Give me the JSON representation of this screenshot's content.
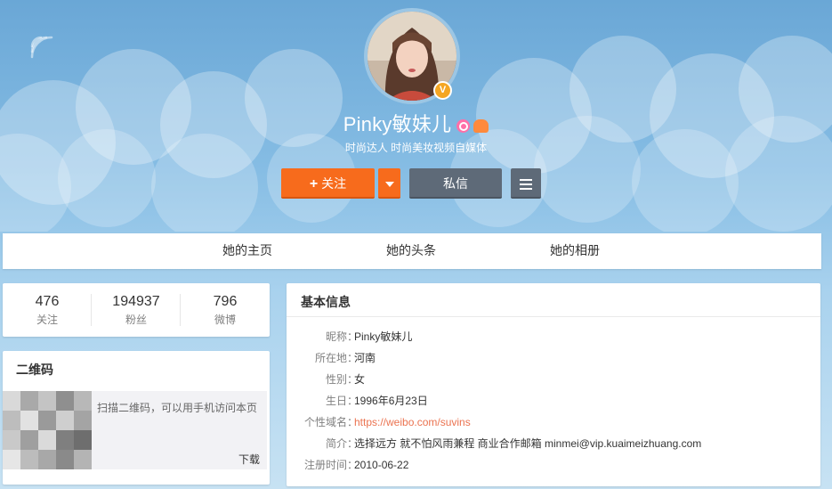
{
  "profile": {
    "username": "Pinky敏妹儿",
    "verified_badge": "V",
    "subtitle": "时尚达人 时尚美妆视频自媒体"
  },
  "actions": {
    "follow_plus": "+",
    "follow_label": "关注",
    "message_label": "私信"
  },
  "nav": {
    "tabs": [
      {
        "label": "她的主页"
      },
      {
        "label": "她的头条"
      },
      {
        "label": "她的相册"
      }
    ]
  },
  "stats": [
    {
      "value": "476",
      "label": "关注"
    },
    {
      "value": "194937",
      "label": "粉丝"
    },
    {
      "value": "796",
      "label": "微博"
    }
  ],
  "qr": {
    "title": "二维码",
    "text": "扫描二维码，可以用手机访问本页",
    "download_label": "下载"
  },
  "info": {
    "title": "基本信息",
    "rows": [
      {
        "key": "昵称：",
        "value": "Pinky敏妹儿"
      },
      {
        "key": "所在地：",
        "value": "河南"
      },
      {
        "key": "性别：",
        "value": "女"
      },
      {
        "key": "生日：",
        "value": "1996年6月23日"
      },
      {
        "key": "个性域名：",
        "value": "https://weibo.com/suvins"
      },
      {
        "key": "简介：",
        "value": "选择远方 就不怕风雨兼程 商业合作邮箱 minmei@vip.kuaimeizhuang.com"
      },
      {
        "key": "注册时间：",
        "value": "2010-06-22"
      }
    ]
  },
  "colors": {
    "accent_orange": "#f76b1c",
    "link": "#eb7350",
    "dark_button": "#5e6a78"
  },
  "icons": {
    "signal": "signal-icon",
    "verified": "verified-badge-icon",
    "dropdown": "caret-down-icon",
    "menu": "hamburger-menu-icon"
  }
}
